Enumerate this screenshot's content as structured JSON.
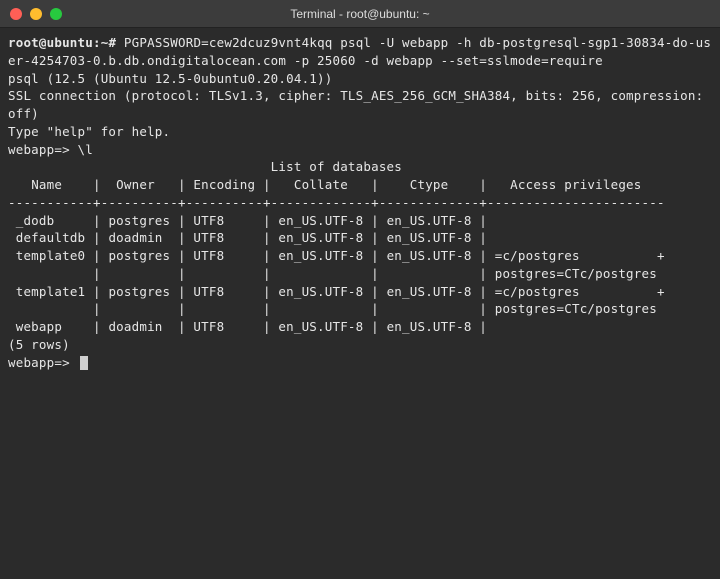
{
  "window": {
    "title": "Terminal - root@ubuntu: ~"
  },
  "prompt": {
    "user_host": "root@ubuntu",
    "path": "~",
    "symbol": "#"
  },
  "command": "PGPASSWORD=cew2dcuz9vnt4kqq psql -U webapp -h db-postgresql-sgp1-30834-do-user-4254703-0.b.db.ondigitalocean.com -p 25060 -d webapp --set=sslmode=require",
  "output": {
    "version_line": "psql (12.5 (Ubuntu 12.5-0ubuntu0.20.04.1))",
    "ssl_line": "SSL connection (protocol: TLSv1.3, cipher: TLS_AES_256_GCM_SHA384, bits: 256, compression: off)",
    "help_line": "Type \"help\" for help.",
    "blank": ""
  },
  "psql_prompt": {
    "db": "webapp",
    "symbol": "=>"
  },
  "psql_command": "\\l",
  "table": {
    "title": "List of databases",
    "header": "   Name    |  Owner   | Encoding |   Collate   |    Ctype    |   Access privileges   ",
    "divider": "-----------+----------+----------+-------------+-------------+-----------------------",
    "rows": [
      " _dodb     | postgres | UTF8     | en_US.UTF-8 | en_US.UTF-8 | ",
      " defaultdb | doadmin  | UTF8     | en_US.UTF-8 | en_US.UTF-8 | ",
      " template0 | postgres | UTF8     | en_US.UTF-8 | en_US.UTF-8 | =c/postgres          +",
      "           |          |          |             |             | postgres=CTc/postgres",
      " template1 | postgres | UTF8     | en_US.UTF-8 | en_US.UTF-8 | =c/postgres          +",
      "           |          |          |             |             | postgres=CTc/postgres",
      " webapp    | doadmin  | UTF8     | en_US.UTF-8 | en_US.UTF-8 | "
    ],
    "row_count": "(5 rows)"
  }
}
